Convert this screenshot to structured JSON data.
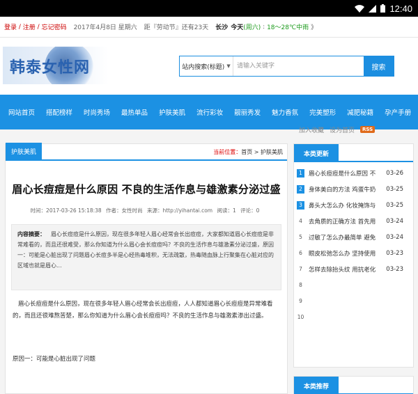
{
  "status_bar": {
    "time": "12:40",
    "icons": [
      "wifi-icon",
      "signal-icon",
      "battery-icon"
    ]
  },
  "topbar": {
    "login": "登录",
    "register": "注册",
    "forgot": "忘记密码",
    "sep": "/",
    "date": "2017年4月8日 星期六",
    "countdown": "距『劳动节』还有23天",
    "city": "长沙",
    "today": "今天",
    "weekday": "(周六)",
    "temp": "18～28℃中雨",
    "chev": "》",
    "favorite": "加入收藏",
    "homepage": "设为首页",
    "rss": "RSS"
  },
  "header": {
    "logo_text": "韩泰女性网",
    "search_scope": "站内搜索(标题)",
    "search_placeholder": "请输入关键字",
    "search_button": "搜索"
  },
  "nav": {
    "items": [
      "网站首页",
      "搭配榜样",
      "时尚秀场",
      "最热单品",
      "护肤美肌",
      "流行彩妆",
      "靓丽秀发",
      "魅力香氛",
      "完美塑形",
      "减肥秘籍",
      "孕产手册"
    ]
  },
  "article": {
    "tab": "护肤美肌",
    "crumb_label": "当前位置：",
    "crumb_home": "首页",
    "crumb_sep": " > ",
    "crumb_section": "护肤美肌",
    "title": "眉心长痘痘是什么原因 不良的生活作息与雄激素分泌过盛",
    "meta": {
      "time": "时间：2017-03-26 15:18:38",
      "author": "作者：女性时尚",
      "source": "来源：http://yihantai.com",
      "reads": "阅读：1",
      "comments": "评论：0"
    },
    "summary_label": "内容摘要：",
    "summary": "眉心长痘痘是什么原因，现在很多年轻人眉心经常会长出痘痘，大家都知道眉心长痘痘是非常难看的，而且还很难受，那么你知道为什么眉心会长痘痘吗？不良的生活作息与雄激素分泌过盛，原因一：可能是心脏出现了问题眉心长痘多半是心经热毒堆积，无法疏散，热毒随血脉上行聚集在心脏对应的区域也就是眉心...",
    "body_para1": "眉心长痘痘是什么原因，现在很多年轻人眉心经常会长出痘痘，人人都知道眉心长痘痘是异常难看的，而且还很难熬苦楚，那么你知道为什么眉心会长痘痘吗？不良的生活作息与雄激素渗出过盛。",
    "body_para2": "原因一：可能是心脏出现了问题"
  },
  "sidebar": {
    "latest_title": "本类更新",
    "latest": [
      {
        "num": "1",
        "title": "眉心长痘痘是什么原因 不",
        "date": "03-26"
      },
      {
        "num": "2",
        "title": "身体美白的方法 鸡蛋牛奶",
        "date": "03-25"
      },
      {
        "num": "3",
        "title": "鼻头大怎么办 化妆掩饰与",
        "date": "03-25"
      },
      {
        "num": "4",
        "title": "去角质的正确方法 首先用",
        "date": "03-24"
      },
      {
        "num": "5",
        "title": "过敏了怎么办最简单 避免",
        "date": "03-24"
      },
      {
        "num": "6",
        "title": "眼皮松弛怎么办 坚持使用",
        "date": "03-23"
      },
      {
        "num": "7",
        "title": "怎样去除抬头纹 用抗老化",
        "date": "03-23"
      },
      {
        "num": "8",
        "title": "",
        "date": ""
      },
      {
        "num": "9",
        "title": "",
        "date": ""
      },
      {
        "num": "10",
        "title": "",
        "date": ""
      }
    ],
    "recommend_title": "本类推荐"
  },
  "colors": {
    "accent": "#1c91e3",
    "red": "#cc0000",
    "green": "#1a9a1a",
    "rss": "#e06a1a"
  }
}
